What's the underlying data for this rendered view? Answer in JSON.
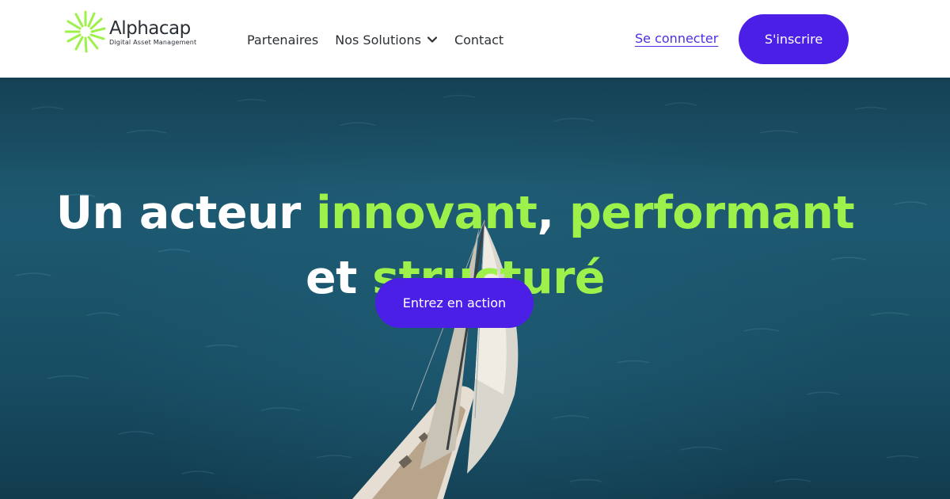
{
  "brand": {
    "name": "Alphacap",
    "tagline": "Digital Asset Management",
    "logo_icon": "sunburst-logo-icon",
    "logo_color": "#9ef04a"
  },
  "nav": {
    "items": [
      {
        "label": "Partenaires"
      },
      {
        "label": "Nos Solutions",
        "icon": "chevron-down-icon"
      },
      {
        "label": "Contact"
      }
    ]
  },
  "auth": {
    "login_label": "Se connecter",
    "signup_label": "S'inscrire"
  },
  "hero": {
    "line1_plain": "Un acteur ",
    "line1_accent_a": "innovant",
    "line1_comma": ", ",
    "line1_accent_b": "performant",
    "line2_plain": "et ",
    "line2_accent": "structuré",
    "cta_label": "Entrez en action",
    "background": "aerial-ocean-sailboat-image"
  },
  "colors": {
    "primary": "#4b1fe6",
    "accent": "#9ef04a",
    "text_dark": "#2b3035",
    "ocean": "#1b4d62"
  }
}
